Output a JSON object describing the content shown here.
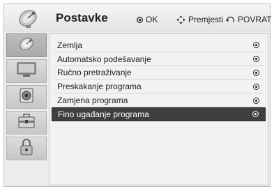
{
  "header": {
    "title": "Postavke",
    "icon": "satellite-dish-icon",
    "hints": {
      "ok": "OK",
      "move": "Premjesti",
      "back": "POVRAT"
    }
  },
  "sidebar": {
    "items": [
      {
        "icon": "satellite-dish-icon",
        "active": true
      },
      {
        "icon": "monitor-icon",
        "active": false
      },
      {
        "icon": "speaker-icon",
        "active": false
      },
      {
        "icon": "toolbox-icon",
        "active": false
      },
      {
        "icon": "padlock-icon",
        "active": false
      }
    ]
  },
  "menu": {
    "items": [
      {
        "label": "Zemlja"
      },
      {
        "label": "Automatsko podešavanje"
      },
      {
        "label": "Ručno pretraživanje"
      },
      {
        "label": "Preskakanje programa"
      },
      {
        "label": "Zamjena programa"
      },
      {
        "label": "Fino ugađanje programa"
      }
    ],
    "selected_index": 5
  },
  "colors": {
    "selected_bg": "#3e3e3e",
    "panel_bg": "#f2f2f2"
  }
}
